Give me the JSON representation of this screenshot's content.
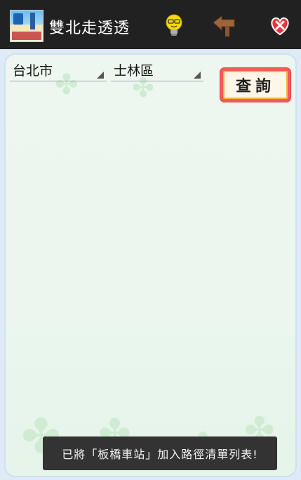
{
  "actionbar": {
    "title": "雙北走透透",
    "icons": [
      "app-logo-icon",
      "lightbulb-icon",
      "back-arrow-icon",
      "heart-close-icon"
    ]
  },
  "filters": {
    "city": "台北市",
    "district": "士林區"
  },
  "query_button": {
    "label": "查詢"
  },
  "toast": {
    "message": "已將「板橋車站」加入路徑清單列表!"
  },
  "colors": {
    "actionbar_bg": "#212121",
    "panel_bg": "#eaf6ee",
    "query_border": "#f25b5b",
    "bulb": "#f5d90a",
    "heart": "#e5343b",
    "toast_bg": "#333333"
  }
}
